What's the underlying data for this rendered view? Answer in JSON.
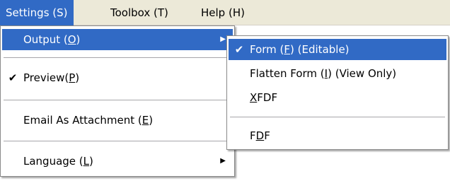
{
  "menubar": {
    "items": [
      {
        "label": "Settings (S)"
      },
      {
        "label": "Toolbox (T)"
      },
      {
        "label": "Help (H)"
      }
    ]
  },
  "settings_menu": {
    "output": {
      "text": "Output (",
      "key": "O",
      "tail": ")"
    },
    "preview": {
      "text": "Preview(",
      "key": "P",
      "tail": ")",
      "checked": true
    },
    "email": {
      "text": "Email As Attachment (",
      "key": "E",
      "tail": ")"
    },
    "language": {
      "text": "Language (",
      "key": "L",
      "tail": ")"
    }
  },
  "output_submenu": {
    "form": {
      "text": "Form (",
      "key": "F",
      "tail": ") (Editable)",
      "checked": true
    },
    "flatten": {
      "text": "Flatten Form (",
      "key": "I",
      "tail": ") (View Only)"
    },
    "xfdf": {
      "key": "X",
      "tail": "FDF"
    },
    "fdf": {
      "text": "F",
      "key": "D",
      "tail": "F"
    }
  },
  "glyphs": {
    "check": "✔",
    "submenu_arrow": "▶"
  },
  "colors": {
    "menubar_bg": "#ece9d8",
    "highlight": "#316ac5"
  }
}
